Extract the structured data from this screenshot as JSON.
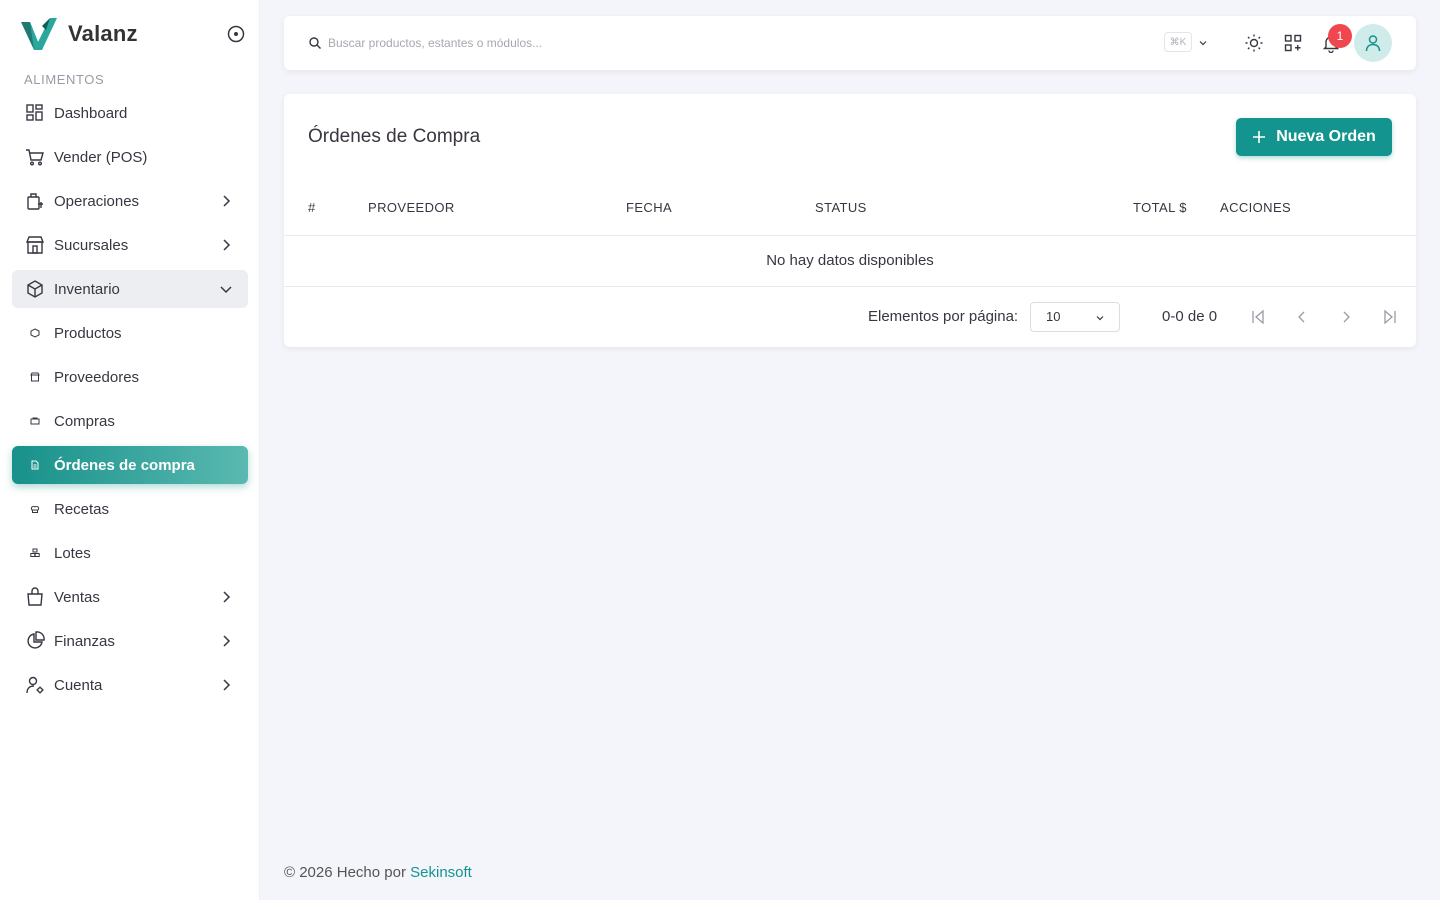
{
  "brand": {
    "name": "Valanz"
  },
  "sidebar": {
    "section_title": "ALIMENTOS",
    "items": [
      {
        "label": "Dashboard",
        "icon": "dashboard-icon"
      },
      {
        "label": "Vender (POS)",
        "icon": "cart-icon"
      },
      {
        "label": "Operaciones",
        "icon": "operations-icon",
        "has_submenu": true
      },
      {
        "label": "Sucursales",
        "icon": "store-icon",
        "has_submenu": true
      },
      {
        "label": "Inventario",
        "icon": "box-icon",
        "has_submenu": true,
        "expanded": true
      },
      {
        "label": "Productos",
        "icon": "product-icon",
        "sub": true
      },
      {
        "label": "Proveedores",
        "icon": "supplier-icon",
        "sub": true
      },
      {
        "label": "Compras",
        "icon": "purchases-icon",
        "sub": true
      },
      {
        "label": "Órdenes de compra",
        "icon": "order-icon",
        "sub": true,
        "active": true
      },
      {
        "label": "Recetas",
        "icon": "recipe-icon",
        "sub": true
      },
      {
        "label": "Lotes",
        "icon": "lots-icon",
        "sub": true
      },
      {
        "label": "Ventas",
        "icon": "bag-icon",
        "has_submenu": true
      },
      {
        "label": "Finanzas",
        "icon": "pie-chart-icon",
        "has_submenu": true
      },
      {
        "label": "Cuenta",
        "icon": "user-gear-icon",
        "has_submenu": true
      }
    ]
  },
  "header": {
    "search_placeholder": "Buscar productos, estantes o módulos...",
    "shortcut": "⌘K",
    "notifications_count": "1"
  },
  "page": {
    "title": "Órdenes de Compra",
    "new_button": "Nueva Orden",
    "table": {
      "columns": [
        "#",
        "PROVEEDOR",
        "FECHA",
        "STATUS",
        "TOTAL $",
        "ACCIONES"
      ],
      "rows": [],
      "empty_text": "No hay datos disponibles"
    },
    "pagination": {
      "per_page_label": "Elementos por página:",
      "per_page_value": "10",
      "range_text": "0-0 de 0"
    }
  },
  "footer": {
    "text": "© 2026 Hecho por",
    "link": "Sekinsoft"
  },
  "colors": {
    "accent": "#14948e",
    "badge": "#f0464f",
    "background": "#f4f5fa"
  }
}
